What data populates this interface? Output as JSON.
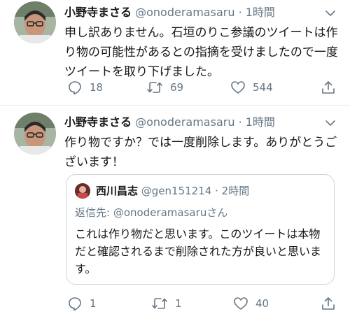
{
  "tweets": [
    {
      "author": {
        "name": "小野寺まさる",
        "handle": "@onoderamasaru"
      },
      "separator": "·",
      "time": "1時間",
      "text": "申し訳ありません。石垣のりこ参議のツイートは作り物の可能性があるとの指摘を受けましたので一度ツイートを取り下げました。",
      "stats": {
        "replies": "18",
        "retweets": "69",
        "likes": "544"
      }
    },
    {
      "author": {
        "name": "小野寺まさる",
        "handle": "@onoderamasaru"
      },
      "separator": "·",
      "time": "1時間",
      "text": "作り物ですか？では一度削除します。ありがとうございます！",
      "quoted": {
        "author": {
          "name": "西川昌志",
          "handle": "@gen151214"
        },
        "separator": "·",
        "time": "2時間",
        "reply_prefix": "返信先: ",
        "reply_mention": "@onoderamasaru",
        "reply_suffix": "さん",
        "text": "これは作り物だと思います。このツイートは本物だと確認されるまで削除された方が良いと思います。"
      },
      "stats": {
        "replies": "1",
        "retweets": "1",
        "likes": "40"
      }
    }
  ],
  "colors": {
    "text": "#14171a",
    "secondary": "#657786",
    "border": "#e6ecf0",
    "quote_border": "#ccd6dd"
  },
  "icons": [
    "reply-icon",
    "retweet-icon",
    "like-icon",
    "share-icon",
    "chevron-down-icon"
  ]
}
